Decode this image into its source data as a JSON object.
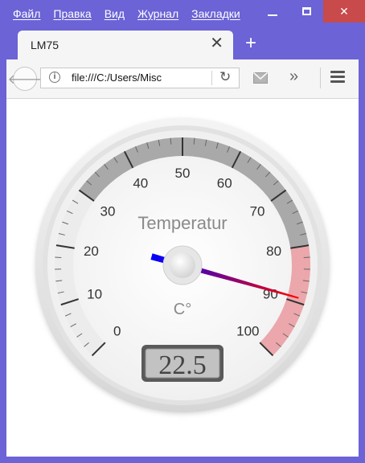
{
  "menu": [
    "Файл",
    "Правка",
    "Вид",
    "Журнал",
    "Закладки"
  ],
  "tab": {
    "title": "LM75"
  },
  "url": {
    "value": "file:///C:/Users/Misc"
  },
  "gauge": {
    "title": "Temperatur",
    "units": "C°",
    "value": 22.5,
    "value_text": "22.5",
    "min": 0,
    "max": 100,
    "major_ticks": [
      "0",
      "10",
      "20",
      "30",
      "40",
      "50",
      "60",
      "70",
      "80",
      "90",
      "100"
    ],
    "highlights": [
      {
        "from": 0,
        "to": 30,
        "color": "#ececec"
      },
      {
        "from": 30,
        "to": 80,
        "color": "#a9a9a9"
      },
      {
        "from": 80,
        "to": 100,
        "color": "#eba7ab"
      }
    ],
    "needle_colors": [
      "#0000ff",
      "#ff0000"
    ]
  },
  "icons": [
    "back-arrow-icon",
    "info-icon",
    "reload-icon",
    "mail-icon",
    "overflow-icon",
    "hamburger-menu-icon",
    "close-icon",
    "plus-icon",
    "minimize-icon",
    "maximize-icon",
    "window-close-icon"
  ]
}
